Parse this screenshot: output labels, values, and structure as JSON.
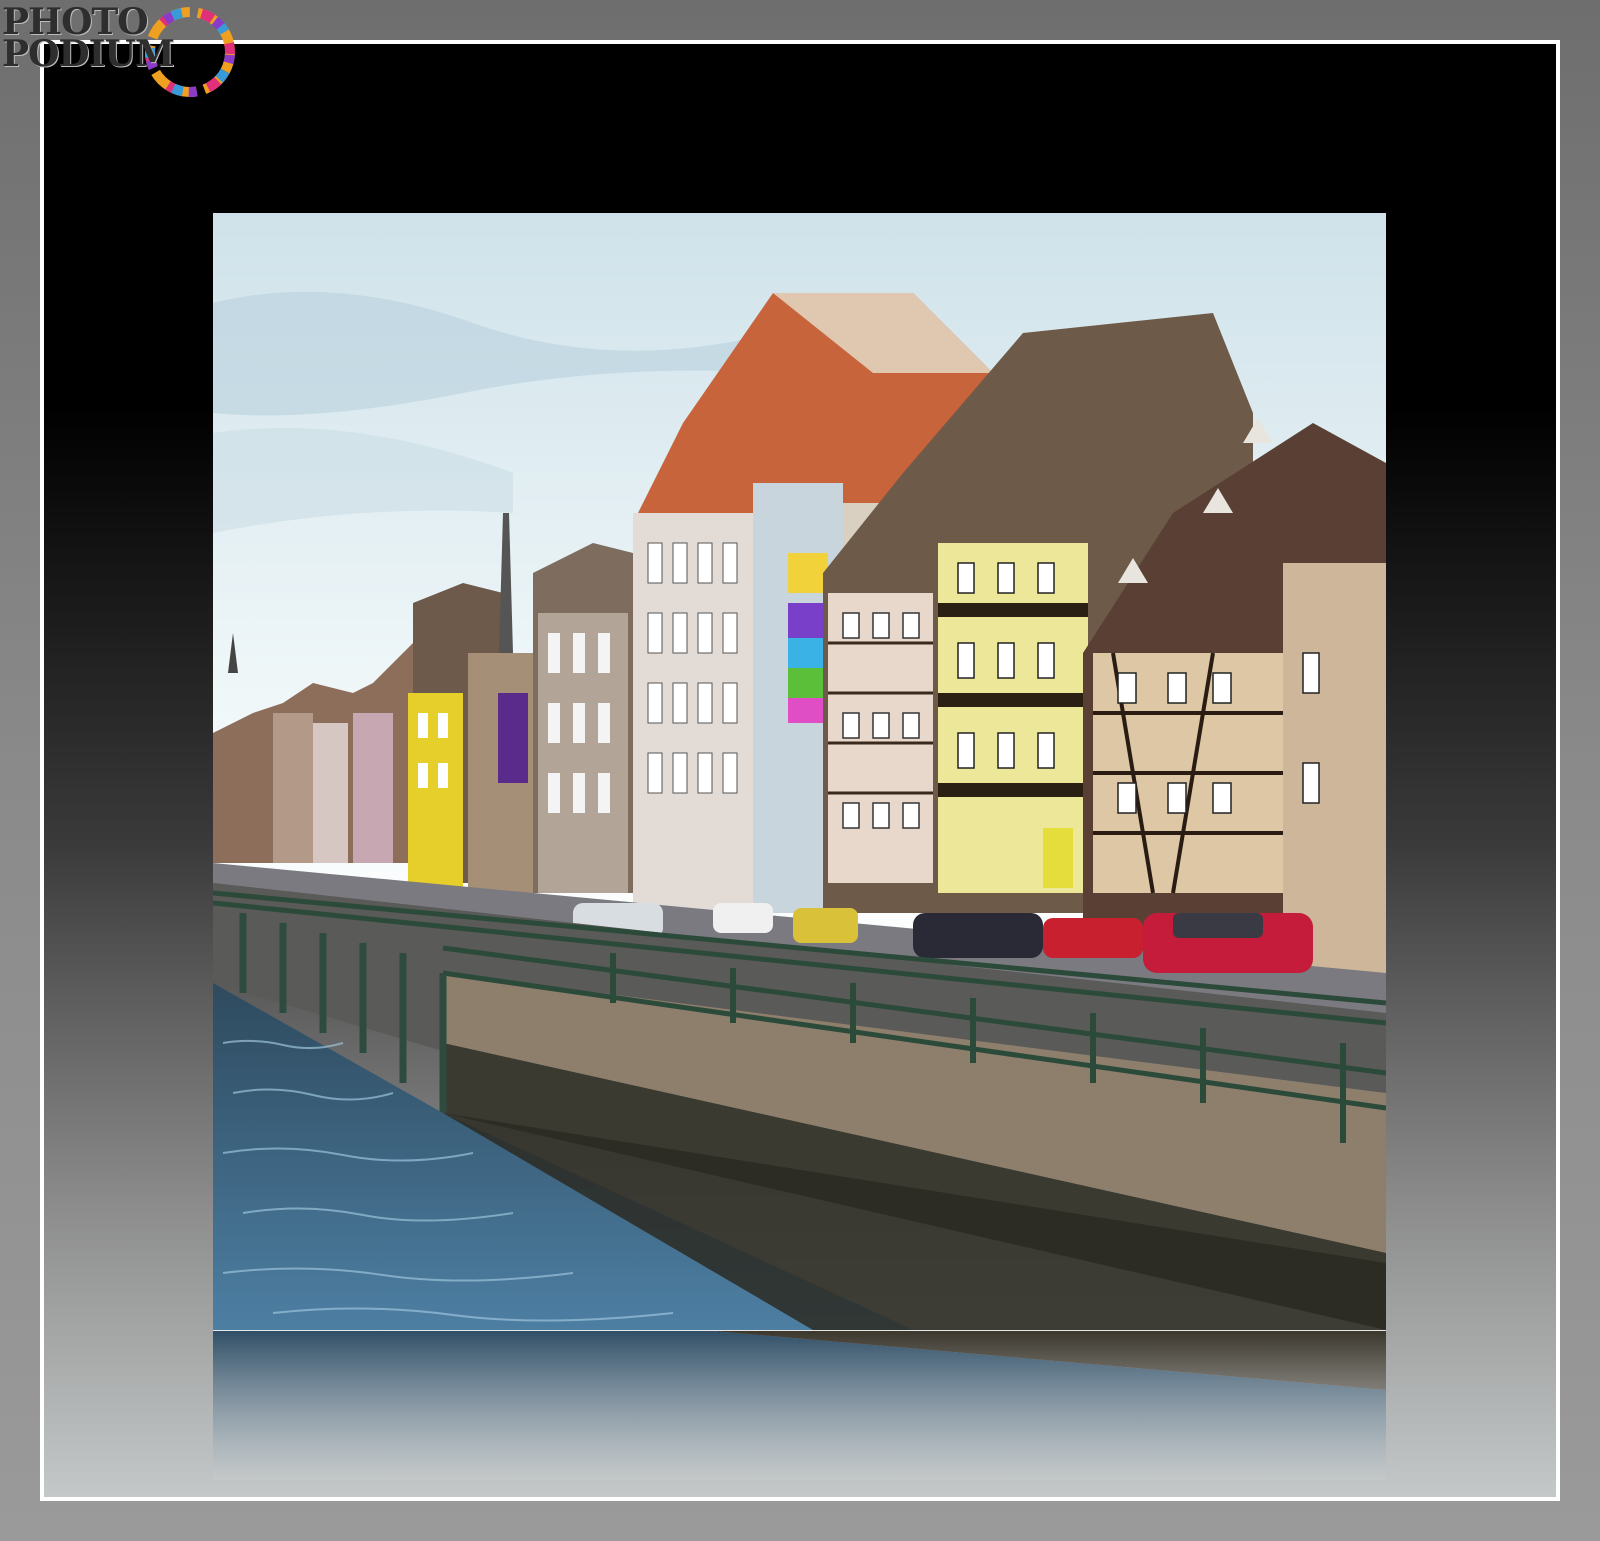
{
  "logo": {
    "line1": "PHOTO",
    "line2": "PODIUM"
  },
  "colors": {
    "frame_white": "#ffffff",
    "sky": "#dfeef4",
    "water": "#3e6a86",
    "roof": "#8a5a3c",
    "timber_yellow": "#e6e08a",
    "car_red": "#c8202e"
  }
}
